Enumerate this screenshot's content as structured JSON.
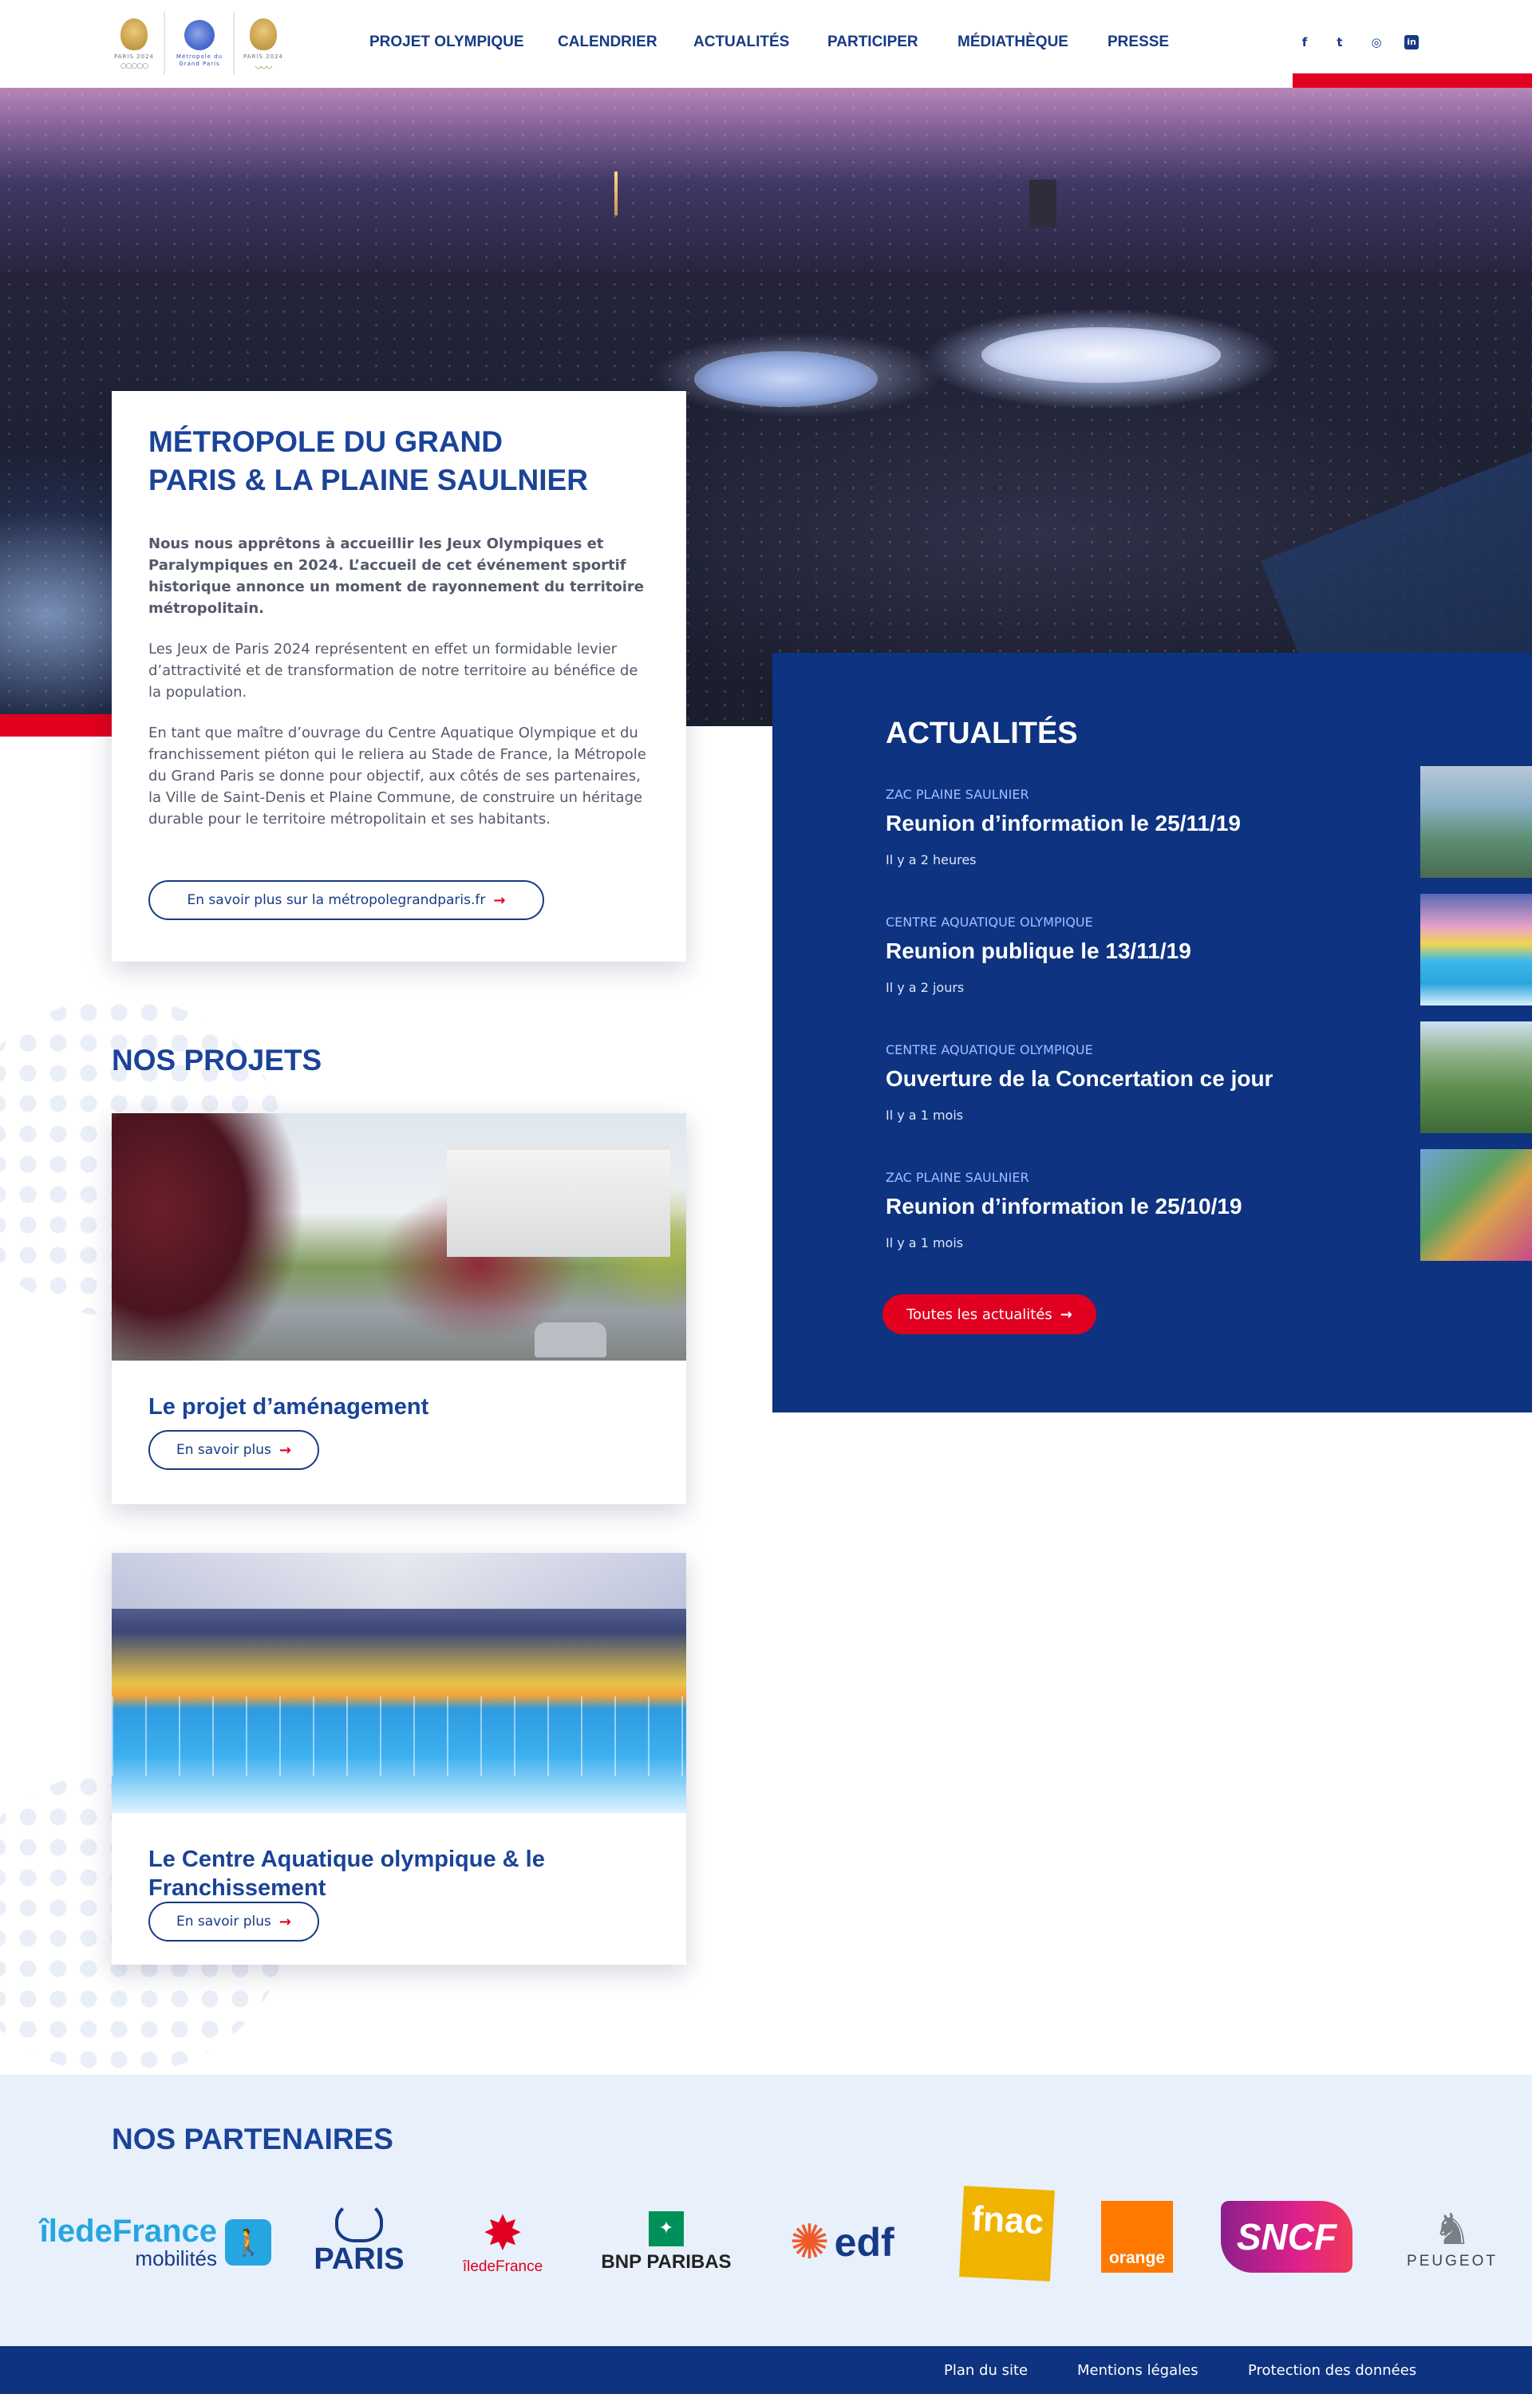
{
  "header": {
    "logos": [
      {
        "name": "paris-2024-logo",
        "text": "PARIS 2024"
      },
      {
        "name": "metropole-grand-paris-logo",
        "text": "Métropole du Grand Paris"
      },
      {
        "name": "paris-2024-paralympic-logo",
        "text": "PARIS 2024"
      }
    ],
    "nav": [
      "PROJET OLYMPIQUE",
      "CALENDRIER",
      "ACTUALITÉS",
      "PARTICIPER",
      "MÉDIATHÈQUE",
      "PRESSE"
    ],
    "social": [
      {
        "icon": "facebook-icon",
        "glyph": "f"
      },
      {
        "icon": "twitter-icon",
        "glyph": "t"
      },
      {
        "icon": "instagram-icon",
        "glyph": "◎"
      },
      {
        "icon": "linkedin-icon",
        "glyph": "in"
      }
    ]
  },
  "intro": {
    "title": "MÉTROPOLE DU GRAND PARIS & LA PLAINE SAULNIER",
    "lead": "Nous nous apprêtons à accueillir les Jeux Olympiques et Paralympiques en 2024. L’accueil de cet événement sportif historique annonce un moment de rayonnement du territoire métropolitain.",
    "p1": "Les Jeux de Paris 2024 représentent en effet un formidable levier d’attractivité et de transformation de notre territoire au bénéfice de la population.",
    "p2": "En tant que maître d’ouvrage du Centre Aquatique Olympique et du franchissement piéton qui le reliera au Stade de France, la Métropole du Grand Paris se donne pour objectif, aux côtés de ses partenaires, la Ville de Saint-Denis et Plaine Commune, de construire un héritage durable pour le territoire métropolitain et ses habitants.",
    "button": "En savoir plus sur la métropolegrandparis.fr"
  },
  "news": {
    "title": "ACTUALITÉS",
    "items": [
      {
        "category": "ZAC PLAINE SAULNIER",
        "title": "Reunion d’information le 25/11/19",
        "time": "Il y a 2 heures"
      },
      {
        "category": "CENTRE AQUATIQUE OLYMPIQUE",
        "title": "Reunion publique le 13/11/19",
        "time": "Il y a 2 jours"
      },
      {
        "category": "CENTRE AQUATIQUE OLYMPIQUE",
        "title": "Ouverture de la Concertation ce jour",
        "time": "Il y a 1 mois"
      },
      {
        "category": "ZAC PLAINE SAULNIER",
        "title": "Reunion d’information le 25/10/19",
        "time": "Il y a 1 mois"
      }
    ],
    "button": "Toutes les actualités"
  },
  "projects": {
    "title": "NOS PROJETS",
    "items": [
      {
        "title": "Le projet d’aménagement",
        "button": "En savoir plus"
      },
      {
        "title": "Le Centre Aquatique olympique & le Franchissement",
        "button": "En savoir plus"
      }
    ]
  },
  "partners": {
    "title": "NOS PARTENAIRES",
    "items": [
      {
        "name": "iledefrance-mobilites",
        "line1": "îledeFrance",
        "line2": "mobilités"
      },
      {
        "name": "paris",
        "line1": "PARIS"
      },
      {
        "name": "iledefrance",
        "line1": "îledeFrance"
      },
      {
        "name": "bnp-paribas",
        "line1": "BNP PARIBAS"
      },
      {
        "name": "edf",
        "line1": "edf"
      },
      {
        "name": "fnac",
        "line1": "fnac"
      },
      {
        "name": "orange",
        "line1": "orange"
      },
      {
        "name": "sncf",
        "line1": "SNCF"
      },
      {
        "name": "peugeot",
        "line1": "PEUGEOT"
      }
    ]
  },
  "footer": {
    "links": [
      "Plan du site",
      "Mentions légales",
      "Protection des données"
    ]
  },
  "colors": {
    "brand_blue": "#1a4399",
    "navy": "#0d3381",
    "accent_red": "#e1001f",
    "partners_bg": "#e8f0fb"
  }
}
